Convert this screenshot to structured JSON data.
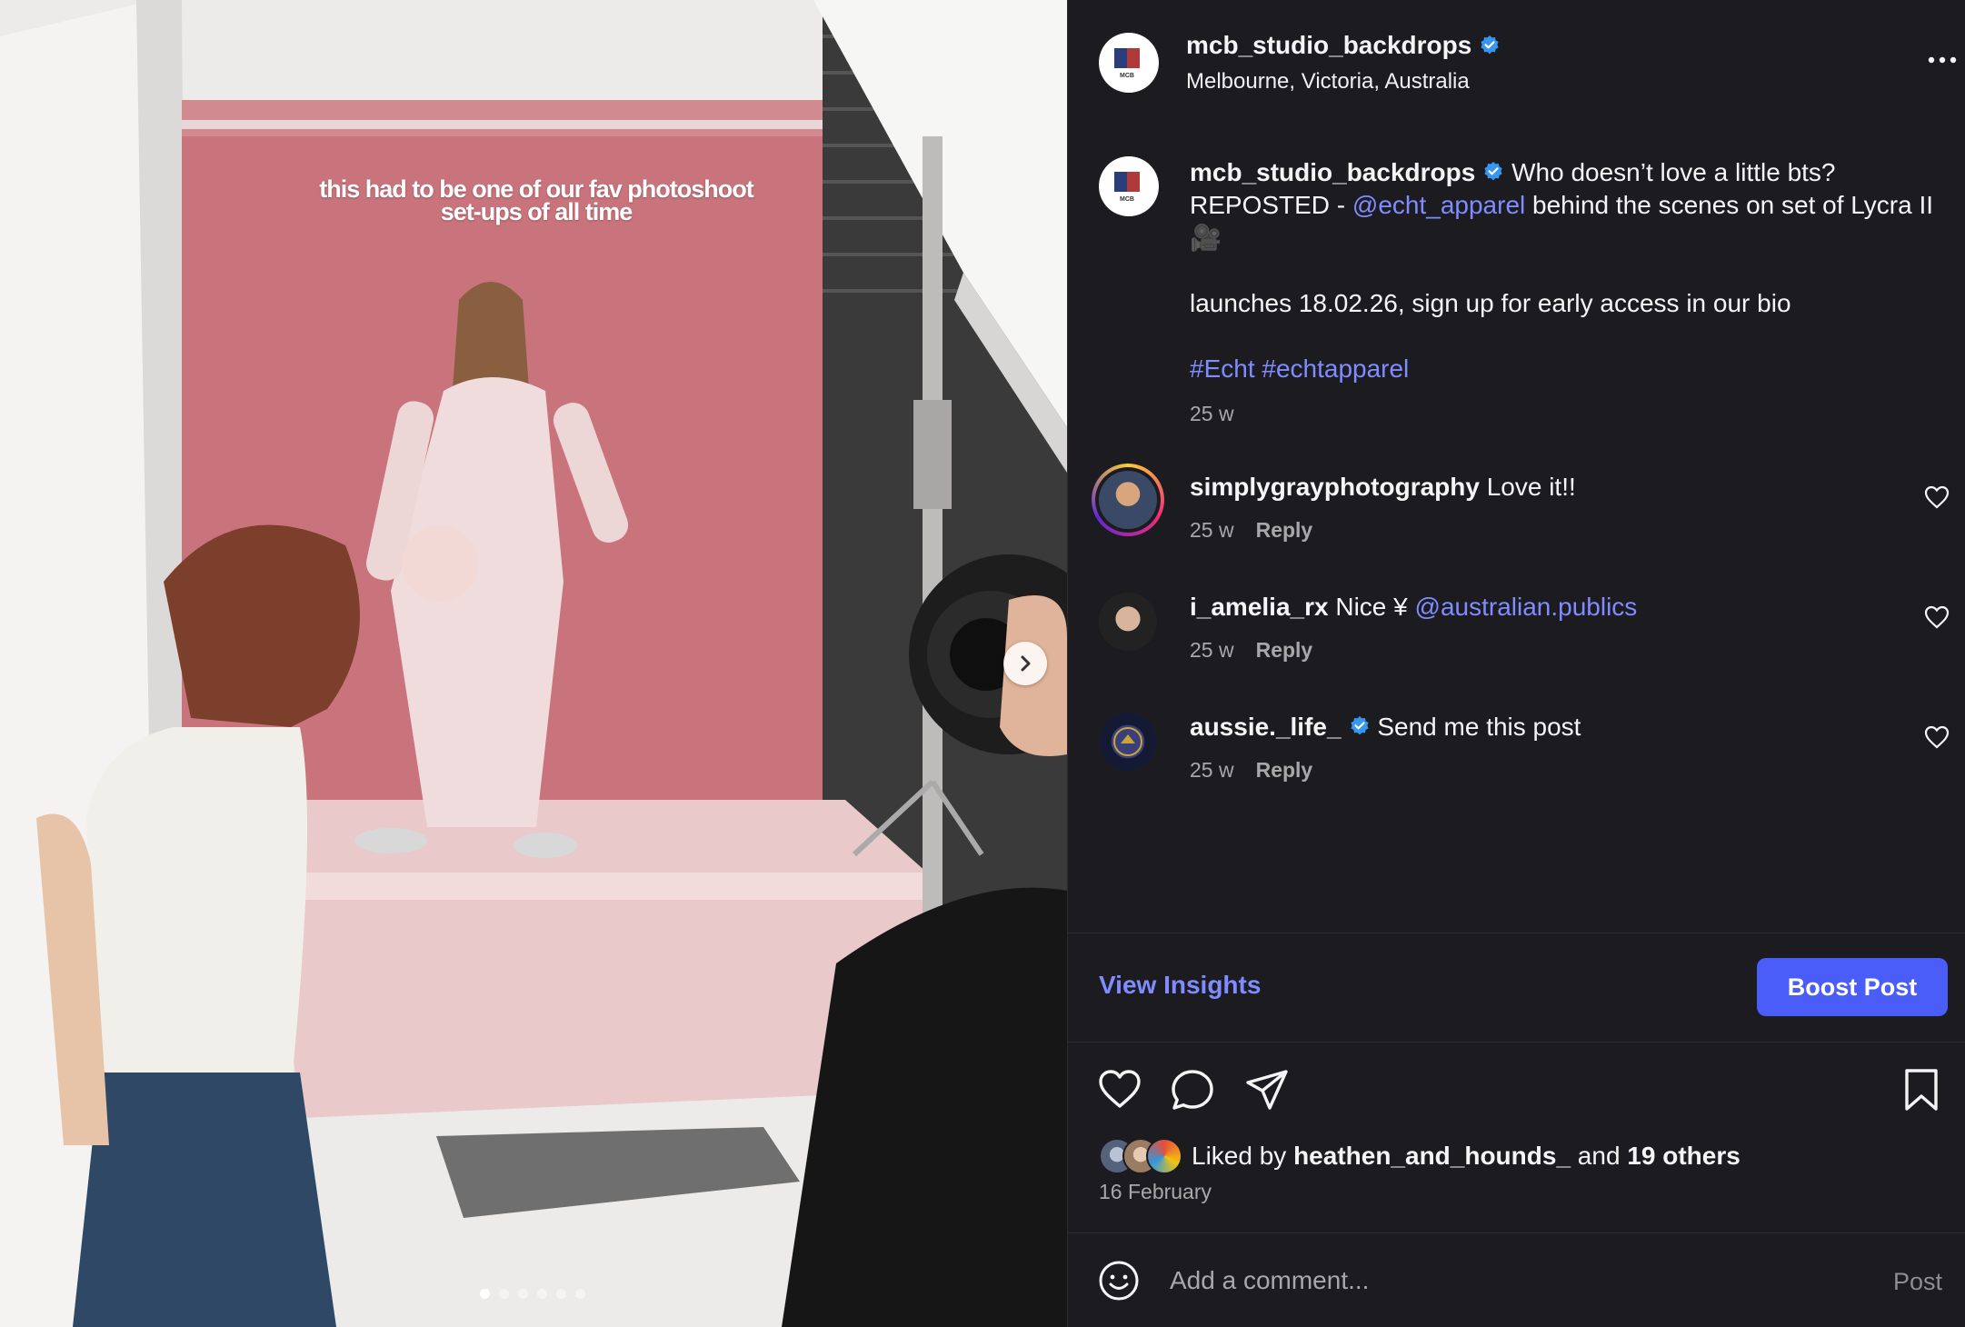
{
  "media": {
    "overlay_text": "this had to be one of our fav photoshoot set-ups of all time",
    "slide_count": 6,
    "active_slide": 1
  },
  "post": {
    "username": "mcb_studio_backdrops",
    "location": "Melbourne, Victoria, Australia",
    "avatar_text": "MCB",
    "caption": {
      "username": "mcb_studio_backdrops",
      "text_1": " Who doesn’t love a little bts? REPOSTED - ",
      "mention": "@echt_apparel",
      "text_2": " behind the scenes on set of Lycra II 🎥",
      "line2": "launches 18.02.26, sign up for early access in our bio",
      "hashtags": "#Echt #echtapparel",
      "age": "25 w"
    }
  },
  "comments": [
    {
      "username": "simplygrayphotography",
      "text": " Love it!!",
      "mention": "",
      "verified": false,
      "age": "25 w",
      "reply": "Reply"
    },
    {
      "username": "i_amelia_rx",
      "text": " Nice ¥ ",
      "mention": "@australian.publics",
      "verified": false,
      "age": "25 w",
      "reply": "Reply"
    },
    {
      "username": "aussie._life_",
      "text": " Send me this post",
      "mention": "",
      "verified": true,
      "age": "25 w",
      "reply": "Reply"
    }
  ],
  "insights": {
    "view_label": "View Insights",
    "boost_label": "Boost Post"
  },
  "likes": {
    "prefix": "Liked by ",
    "user": "heathen_and_hounds_",
    "middle": " and ",
    "others": "19 others",
    "date": "16 February"
  },
  "comment_bar": {
    "placeholder": "Add a comment...",
    "post_label": "Post"
  },
  "colors": {
    "accent": "#4a5df9",
    "link": "#7f8cff",
    "panel_bg": "#1c1c20",
    "verified": "#3797f0"
  },
  "icons": [
    "more-icon",
    "verified-icon",
    "heart-icon",
    "comment-icon",
    "share-icon",
    "bookmark-icon",
    "emoji-icon",
    "chevron-right-icon"
  ]
}
